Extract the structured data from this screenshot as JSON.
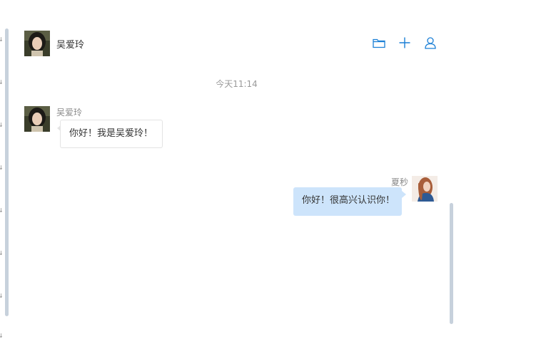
{
  "conversation": {
    "contact_name": "吴爱玲"
  },
  "toolbar": {
    "icons": [
      "folder-icon",
      "plus-icon",
      "user-icon"
    ],
    "accent_color": "#1a7fd6"
  },
  "timestamp": "今天11:14",
  "messages": [
    {
      "direction": "incoming",
      "sender": "吴爱玲",
      "text": "你好！我是吴爱玲！"
    },
    {
      "direction": "outgoing",
      "sender": "夏秒",
      "text": "你好！很高兴认识你！"
    }
  ],
  "colors": {
    "outgoing_bubble": "#cde4fb",
    "incoming_bubble_border": "#e3e3e3",
    "scrollbar": "#c7d1dc"
  }
}
